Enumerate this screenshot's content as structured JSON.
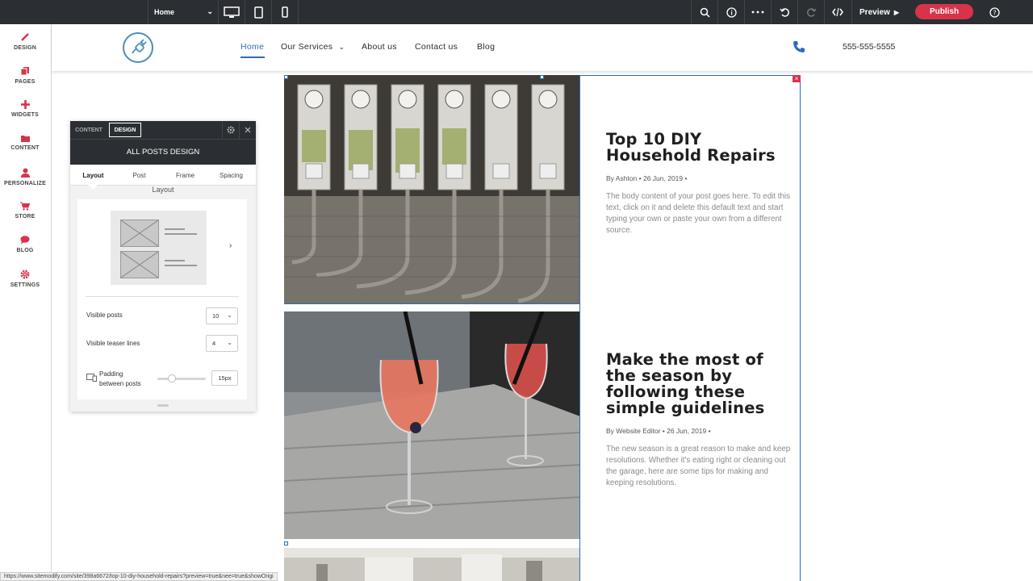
{
  "toolbar": {
    "page_select": "Home",
    "preview_label": "Preview",
    "publish_label": "Publish",
    "icons": [
      "desktop-icon",
      "tablet-icon",
      "mobile-icon",
      "search-icon",
      "info-icon",
      "more-icon",
      "undo-icon",
      "redo-icon",
      "code-icon",
      "help-icon"
    ]
  },
  "sidebar": {
    "items": [
      {
        "label": "DESIGN",
        "icon": "brush-icon"
      },
      {
        "label": "PAGES",
        "icon": "pages-icon"
      },
      {
        "label": "WIDGETS",
        "icon": "plus-icon"
      },
      {
        "label": "CONTENT",
        "icon": "folder-icon"
      },
      {
        "label": "PERSONALIZE",
        "icon": "user-icon"
      },
      {
        "label": "STORE",
        "icon": "cart-icon"
      },
      {
        "label": "BLOG",
        "icon": "chat-icon"
      },
      {
        "label": "SETTINGS",
        "icon": "gear-icon"
      }
    ],
    "accent": "#d8334a"
  },
  "site": {
    "nav": [
      "Home",
      "Our Services",
      "About us",
      "Contact us",
      "Blog"
    ],
    "phone": "555-555-5555",
    "accent": "#2f6db2"
  },
  "posts": [
    {
      "title": "Top 10 DIY Household Repairs",
      "meta": "By Ashton • 26 Jun, 2019 •",
      "body": "The body content of your post goes here. To edit this text, click on it and delete this default text and start typing your own or paste your own from a different source."
    },
    {
      "title": "Make the most of the season by following these simple guidelines",
      "meta": "By Website Editor • 26 Jun, 2019 •",
      "body": "The new season is a great reason to make and keep resolutions. Whether it's eating right or cleaning out the garage, here are some tips for making and keeping resolutions."
    }
  ],
  "panel": {
    "tabs": [
      "CONTENT",
      "DESIGN"
    ],
    "title": "ALL POSTS DESIGN",
    "subtabs": [
      "Layout",
      "Post",
      "Frame",
      "Spacing"
    ],
    "section_title": "Layout",
    "visible_posts_label": "Visible posts",
    "visible_posts_value": "10",
    "teaser_lines_label": "Visible teaser lines",
    "teaser_lines_value": "4",
    "padding_label_1": "Padding",
    "padding_label_2": "between posts",
    "padding_value": "15px",
    "padding_slider_fraction": 0.3
  },
  "status_url": "https://www.sitemodify.com/site/398a6672/top-10-diy-household-repairs?preview=true&nee=true&showOrigi"
}
